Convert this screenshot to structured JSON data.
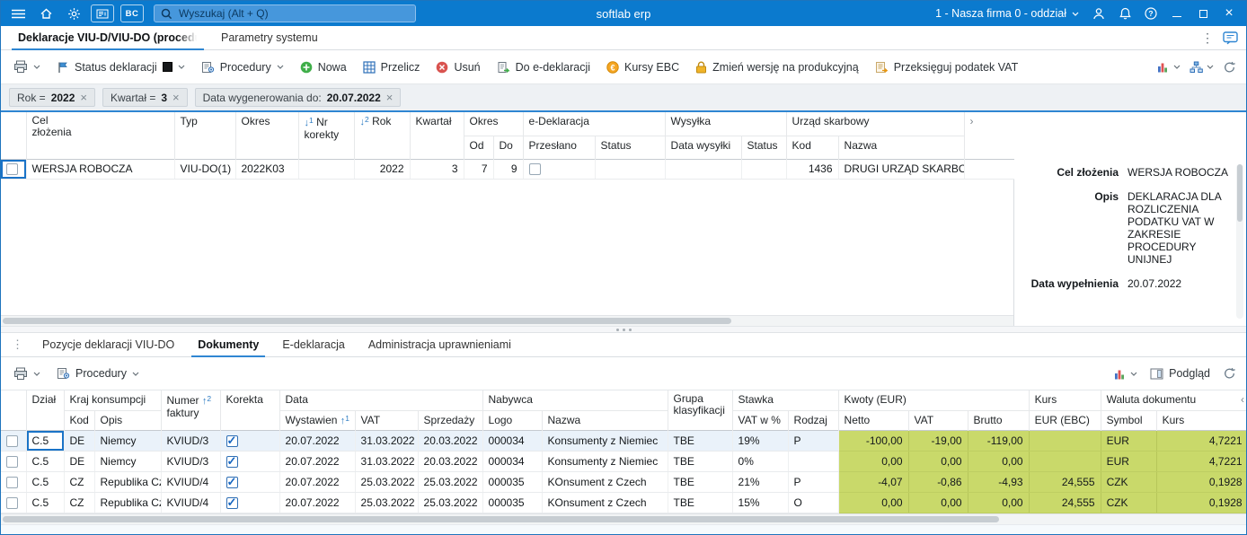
{
  "topbar": {
    "title": "softlab erp",
    "search_placeholder": "Wyszukaj (Alt + Q)",
    "company": "1 - Nasza firma 0 - oddział",
    "bc_label": "BC"
  },
  "tabs": {
    "tab1": "Deklaracje VIU-D/VIU-DO (procedura",
    "tab2": "Parametry systemu"
  },
  "toolbar": {
    "status": "Status deklaracji",
    "procedury": "Procedury",
    "nowa": "Nowa",
    "przelicz": "Przelicz",
    "usun": "Usuń",
    "do_edeklaracji": "Do e-deklaracji",
    "kursy_ebc": "Kursy EBC",
    "zmien_wersje": "Zmień wersję na produkcyjną",
    "przeksieguj": "Przeksięguj podatek VAT"
  },
  "filters": {
    "f1_label": "Rok =",
    "f1_value": "2022",
    "f2_label": "Kwartał =",
    "f2_value": "3",
    "f3_label": "Data wygenerowania  do:",
    "f3_value": "20.07.2022"
  },
  "top_grid": {
    "h_cel_1": "Cel",
    "h_cel_2": "złożenia",
    "h_typ": "Typ",
    "h_okres": "Okres",
    "h_nr_1": "Nr",
    "h_nr_2": "korekty",
    "h_nr_sort": "1",
    "h_rok": "Rok",
    "h_rok_sort": "2",
    "h_kwartal": "Kwartał",
    "h_g_okres": "Okres",
    "h_od": "Od",
    "h_do": "Do",
    "h_g_edek": "e-Deklaracja",
    "h_przeslano": "Przesłano",
    "h_status_e": "Status",
    "h_g_wysylka": "Wysyłka",
    "h_data_wysylki": "Data wysyłki",
    "h_status_w": "Status",
    "h_g_urzad": "Urząd skarbowy",
    "h_kod": "Kod",
    "h_nazwa": "Nazwa",
    "row": {
      "cel": "WERSJA ROBOCZA",
      "typ": "VIU-DO(1)",
      "okres": "2022K03",
      "nr_korekty": "",
      "rok": "2022",
      "kwartal": "3",
      "od": "7",
      "do": "9",
      "przeslano": false,
      "status_e": "",
      "data_wysylki": "",
      "status_w": "",
      "kod": "1436",
      "nazwa": "DRUGI URZĄD SKARBOWY"
    }
  },
  "detail": {
    "f1_label": "Cel złożenia",
    "f1_value": "WERSJA ROBOCZA",
    "f2_label": "Opis",
    "f2_value": "DEKLARACJA DLA ROZLICZENIA PODATKU VAT W ZAKRESIE PROCEDURY UNIJNEJ",
    "f3_label": "Data wypełnienia",
    "f3_value": "20.07.2022"
  },
  "bottom_tabs": {
    "t1": "Pozycje deklaracji VIU-DO",
    "t2": "Dokumenty",
    "t3": "E-deklaracja",
    "t4": "Administracja uprawnieniami"
  },
  "bottom_toolbar": {
    "procedury": "Procedury",
    "podglad": "Podgląd"
  },
  "bottom_grid": {
    "h_dzial": "Dział",
    "h_g_kraj": "Kraj konsumpcji",
    "h_kod": "Kod",
    "h_opis": "Opis",
    "h_numer_1": "Numer",
    "h_numer_2": "faktury",
    "h_numer_sort": "2",
    "h_korekta": "Korekta",
    "h_g_data": "Data",
    "h_wystaw": "Wystawien",
    "h_wystaw_sort": "1",
    "h_vat": "VAT",
    "h_sprzedazy": "Sprzedaży",
    "h_g_nabywca": "Nabywca",
    "h_logo": "Logo",
    "h_nazwa": "Nazwa",
    "h_grupa_1": "Grupa",
    "h_grupa_2": "klasyfikacji",
    "h_g_stawka": "Stawka",
    "h_vat_pct": "VAT w %",
    "h_rodzaj": "Rodzaj",
    "h_g_kwoty": "Kwoty (EUR)",
    "h_netto": "Netto",
    "h_vat2": "VAT",
    "h_brutto": "Brutto",
    "h_g_kurs": "Kurs",
    "h_eur_ebc": "EUR (EBC)",
    "h_g_waluta": "Waluta dokumentu",
    "h_symbol": "Symbol",
    "h_kurs": "Kurs",
    "rows": [
      {
        "dzial": "C.5",
        "kod": "DE",
        "opis": "Niemcy",
        "numer": "KVIUD/3",
        "korekta": true,
        "wystaw": "20.07.2022",
        "vat": "31.03.2022",
        "sprzedazy": "20.03.2022",
        "logo": "000034",
        "nazwa": "Konsumenty z Niemiec",
        "grupa": "TBE",
        "vat_pct": "19%",
        "rodzaj": "P",
        "netto": "-100,00",
        "vat2": "-19,00",
        "brutto": "-119,00",
        "eur_ebc": "",
        "symbol": "EUR",
        "kurs": "4,7221"
      },
      {
        "dzial": "C.5",
        "kod": "DE",
        "opis": "Niemcy",
        "numer": "KVIUD/3",
        "korekta": true,
        "wystaw": "20.07.2022",
        "vat": "31.03.2022",
        "sprzedazy": "20.03.2022",
        "logo": "000034",
        "nazwa": "Konsumenty z Niemiec",
        "grupa": "TBE",
        "vat_pct": "0%",
        "rodzaj": "",
        "netto": "0,00",
        "vat2": "0,00",
        "brutto": "0,00",
        "eur_ebc": "",
        "symbol": "EUR",
        "kurs": "4,7221"
      },
      {
        "dzial": "C.5",
        "kod": "CZ",
        "opis": "Republika Cz",
        "numer": "KVIUD/4",
        "korekta": true,
        "wystaw": "20.07.2022",
        "vat": "25.03.2022",
        "sprzedazy": "25.03.2022",
        "logo": "000035",
        "nazwa": "KOnsument z Czech",
        "grupa": "TBE",
        "vat_pct": "21%",
        "rodzaj": "P",
        "netto": "-4,07",
        "vat2": "-0,86",
        "brutto": "-4,93",
        "eur_ebc": "24,555",
        "symbol": "CZK",
        "kurs": "0,1928"
      },
      {
        "dzial": "C.5",
        "kod": "CZ",
        "opis": "Republika Cz",
        "numer": "KVIUD/4",
        "korekta": true,
        "wystaw": "20.07.2022",
        "vat": "25.03.2022",
        "sprzedazy": "25.03.2022",
        "logo": "000035",
        "nazwa": "KOnsument z Czech",
        "grupa": "TBE",
        "vat_pct": "15%",
        "rodzaj": "O",
        "netto": "0,00",
        "vat2": "0,00",
        "brutto": "0,00",
        "eur_ebc": "24,555",
        "symbol": "CZK",
        "kurs": "0,1928"
      }
    ]
  }
}
